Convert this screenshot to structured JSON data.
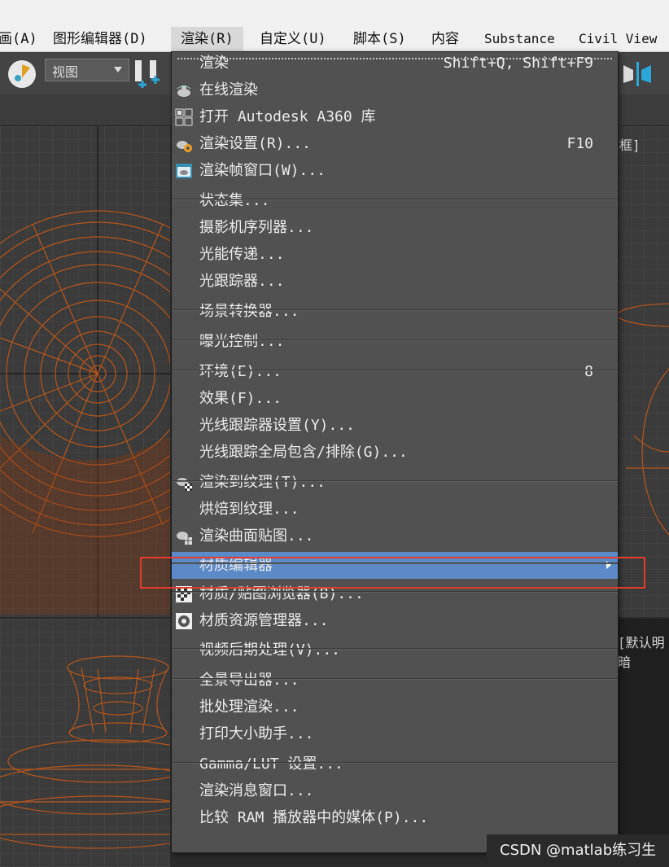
{
  "menubar": {
    "items": [
      "画(A)",
      "图形编辑器(D)",
      "渲染(R)",
      "自定义(U)",
      "脚本(S)",
      "内容",
      "Substance",
      "Civil View"
    ]
  },
  "toolbar": {
    "view_dropdown": "视图"
  },
  "viewports": {
    "top_right_label": "框]",
    "bottom_right_label": "[默认明暗"
  },
  "render_menu": {
    "items": [
      {
        "label": "渲染",
        "shortcut": "Shift+Q, Shift+F9",
        "icon": null
      },
      {
        "label": "在线渲染",
        "shortcut": "",
        "icon": "teapot-cloud-icon"
      },
      {
        "label": "打开 Autodesk A360 库",
        "shortcut": "",
        "icon": "a360-gallery-icon"
      },
      {
        "label": "渲染设置(R)...",
        "shortcut": "F10",
        "icon": "render-setup-icon"
      },
      {
        "label": "渲染帧窗口(W)...",
        "shortcut": "",
        "icon": "rendered-frame-window-icon"
      },
      {
        "label": "状态集...",
        "shortcut": "",
        "icon": null
      },
      {
        "label": "摄影机序列器...",
        "shortcut": "",
        "icon": null
      },
      {
        "label": "光能传递...",
        "shortcut": "",
        "icon": null
      },
      {
        "label": "光跟踪器...",
        "shortcut": "",
        "icon": null
      },
      {
        "label": "场景转换器...",
        "shortcut": "",
        "icon": null
      },
      {
        "label": "曝光控制...",
        "shortcut": "",
        "icon": null
      },
      {
        "label": "环境(E)...",
        "shortcut": "8",
        "icon": null
      },
      {
        "label": "效果(F)...",
        "shortcut": "",
        "icon": null
      },
      {
        "label": "光线跟踪器设置(Y)...",
        "shortcut": "",
        "icon": null
      },
      {
        "label": "光线跟踪全局包含/排除(G)...",
        "shortcut": "",
        "icon": null
      },
      {
        "label": "渲染到纹理(T)...",
        "shortcut": "",
        "icon": "render-to-texture-icon"
      },
      {
        "label": "烘焙到纹理...",
        "shortcut": "",
        "icon": null
      },
      {
        "label": "渲染曲面贴图...",
        "shortcut": "",
        "icon": "render-surface-map-icon"
      },
      {
        "label": "材质编辑器",
        "shortcut": "",
        "icon": null,
        "submenu": true,
        "highlighted": true
      },
      {
        "label": "材质/贴图浏览器(B)...",
        "shortcut": "",
        "icon": "material-map-browser-icon"
      },
      {
        "label": "材质资源管理器...",
        "shortcut": "",
        "icon": "material-explorer-icon"
      },
      {
        "label": "视频后期处理(V)...",
        "shortcut": "",
        "icon": null
      },
      {
        "label": "全景导出器...",
        "shortcut": "",
        "icon": null
      },
      {
        "label": "批处理渲染...",
        "shortcut": "",
        "icon": null
      },
      {
        "label": "打印大小助手...",
        "shortcut": "",
        "icon": null
      },
      {
        "label": "Gamma/LUT 设置...",
        "shortcut": "",
        "icon": null
      },
      {
        "label": "渲染消息窗口...",
        "shortcut": "",
        "icon": null
      },
      {
        "label": "比较 RAM 播放器中的媒体(P)...",
        "shortcut": "",
        "icon": null
      }
    ]
  },
  "watermark": "CSDN @matlab练习生",
  "colors": {
    "wire": "#b5561c",
    "highlight": "#5b8ac7",
    "annotation": "#e33b2e"
  }
}
